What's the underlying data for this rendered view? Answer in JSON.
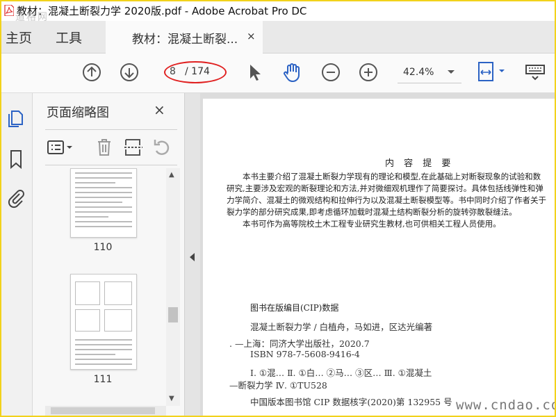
{
  "window": {
    "title": "教材：混凝土断裂力学 2020版.pdf - Adobe Acrobat Pro DC",
    "watermark_top": "道格网"
  },
  "tabs": {
    "home": "主页",
    "tools": "工具",
    "document": "教材：混凝土断裂...",
    "document_close": "×"
  },
  "toolbar": {
    "page_current": "8",
    "page_total": "/ 174",
    "zoom": "42.4%"
  },
  "panel": {
    "title": "页面缩略图",
    "close": "×",
    "thumbnails": [
      {
        "label": "110"
      },
      {
        "label": "111"
      }
    ]
  },
  "document": {
    "heading": "内 容 提 要",
    "summary": [
      "　　本书主要介绍了混凝土断裂力学现有的理论和模型,在此基础上对断裂现象的试验和数",
      "研究,主要涉及宏观的断裂理论和方法,并对微细观机理作了简要探讨。具体包括线弹性和弹",
      "力学简介、混凝土的微观结构和拉伸行为以及混凝土断裂模型等。书中同时介绍了作者关于",
      "裂力学的部分研究成果,即考虑循环加载时混凝土结构断裂分析的旋转弥散裂缝法。",
      "　　本书可作为高等院校土木工程专业研究生教材,也可供相关工程人员使用。"
    ],
    "cip_title": "图书在版编目(CIP)数据",
    "cip_lines": [
      "混凝土断裂力学 / 白植舟，马如进，区达光编著",
      ". —上海：同济大学出版社，2020.7",
      "ISBN 978-7-5608-9416-4",
      "Ⅰ. ①混… Ⅱ. ①白… ②马… ③区… Ⅲ. ①混凝土",
      "—断裂力学 Ⅳ. ①TU528",
      "中国版本图书馆 CIP 数据核字(2020)第 132955 号"
    ]
  },
  "watermark_bottom": "www.cndao.com",
  "colors": {
    "accent": "#2b62c4",
    "annotation": "#e02020",
    "frame": "#f2d21b"
  }
}
